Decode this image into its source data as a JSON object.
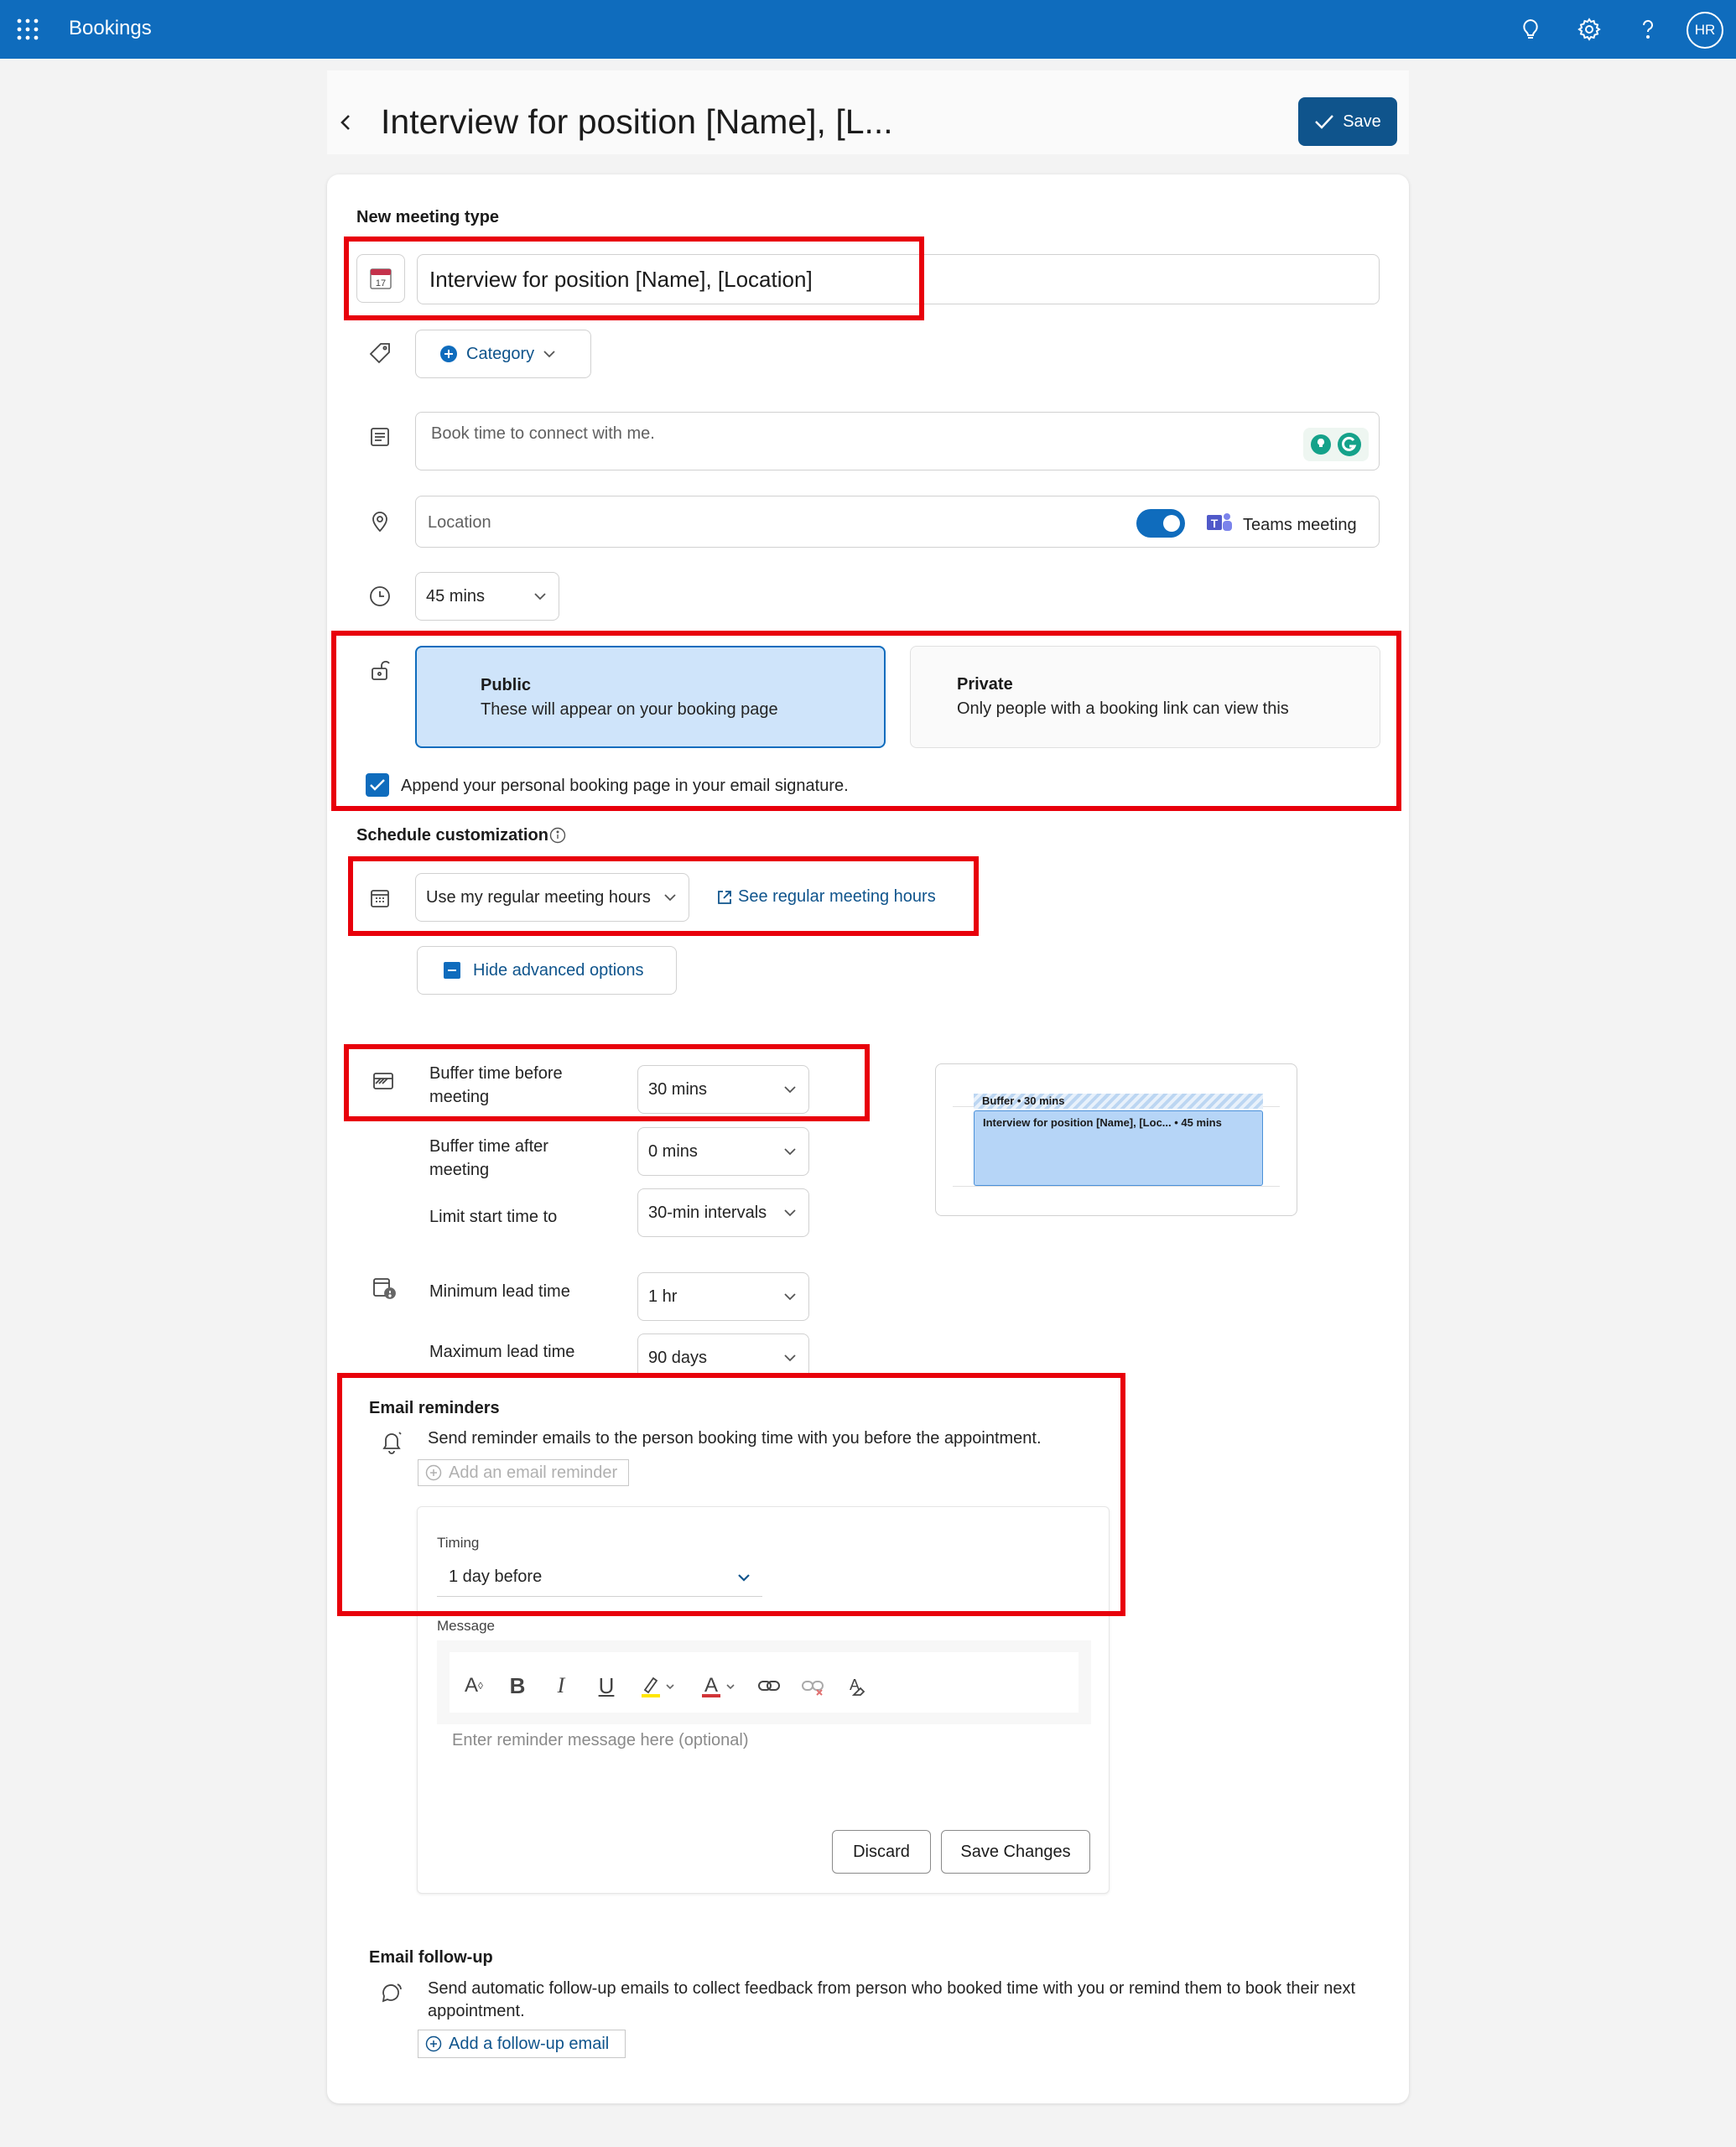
{
  "app": {
    "name": "Bookings",
    "avatar_initials": "HR"
  },
  "header": {
    "title": "Interview for position [Name], [L...",
    "save_label": "Save"
  },
  "meeting": {
    "section_label": "New meeting type",
    "name_value": "Interview for position [Name], [Location]",
    "calendar_icon_day": "17",
    "category_label": "Category",
    "description_placeholder": "Book time to connect with me.",
    "location_placeholder": "Location",
    "teams_label": "Teams meeting",
    "duration": "45 mins"
  },
  "visibility": {
    "public_title": "Public",
    "public_desc": "These will appear on your booking page",
    "private_title": "Private",
    "private_desc": "Only people with a booking link can view this",
    "append_label": "Append your personal booking page in your email signature."
  },
  "schedule": {
    "section_label": "Schedule customization",
    "hours_select": "Use my regular meeting hours",
    "see_hours_link": "See regular meeting hours",
    "hide_advanced": "Hide advanced options",
    "buffer_before_label": "Buffer time before meeting",
    "buffer_before_value": "30 mins",
    "buffer_after_label": "Buffer time after meeting",
    "buffer_after_value": "0 mins",
    "limit_start_label": "Limit start time to",
    "limit_start_value": "30-min intervals",
    "min_lead_label": "Minimum lead time",
    "min_lead_value": "1 hr",
    "max_lead_label": "Maximum lead time",
    "max_lead_value": "90 days",
    "preview_buffer": "Buffer • 30 mins",
    "preview_event": "Interview for position [Name], [Loc... • 45 mins"
  },
  "reminders": {
    "section_label": "Email reminders",
    "desc": "Send reminder emails to the person booking time with you before the appointment.",
    "add_label": "Add an email reminder",
    "timing_label": "Timing",
    "timing_value": "1 day before",
    "message_label": "Message",
    "message_placeholder": "Enter reminder message here (optional)",
    "discard_label": "Discard",
    "save_changes_label": "Save Changes"
  },
  "followup": {
    "section_label": "Email follow-up",
    "desc": "Send automatic follow-up emails to collect feedback from person who booked time with you or remind them to book their next appointment.",
    "add_label": "Add a follow-up email"
  },
  "colors": {
    "brand": "#0f6cbd",
    "highlight_box": "#e8000b",
    "public_card": "#cfe4fa"
  }
}
